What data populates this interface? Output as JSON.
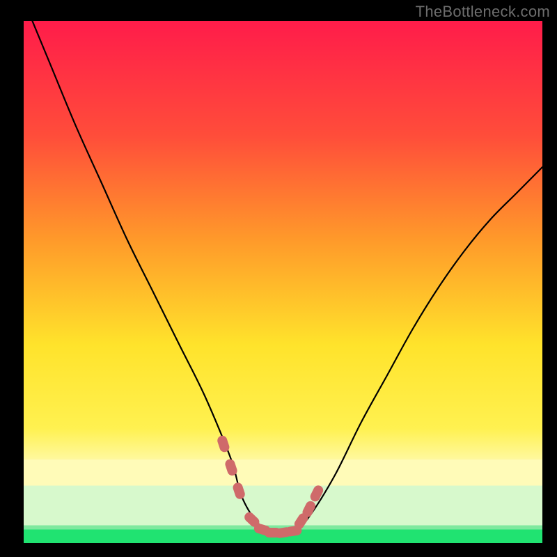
{
  "watermark": "TheBottleneck.com",
  "colors": {
    "black": "#000000",
    "curve": "#000000",
    "marker": "#cf6a6a",
    "green_band": "#20e371",
    "pale_green": "#d7f9cc",
    "grad_top": "#ff1c4a",
    "grad_mid1": "#ff7a2e",
    "grad_mid2": "#ffe32b",
    "grad_pale": "#fffbb8",
    "grad_bottom": "#20e371"
  },
  "chart_data": {
    "type": "line",
    "title": "",
    "xlabel": "",
    "ylabel": "",
    "xlim": [
      0,
      100
    ],
    "ylim": [
      0,
      100
    ],
    "grid": false,
    "legend": false,
    "series": [
      {
        "name": "bottleneck-curve",
        "x": [
          0,
          5,
          10,
          15,
          20,
          25,
          30,
          35,
          40,
          42,
          45,
          48,
          52,
          55,
          60,
          65,
          70,
          75,
          80,
          85,
          90,
          95,
          100
        ],
        "values": [
          104,
          92,
          80,
          69,
          58,
          48,
          38,
          28,
          16,
          9,
          4,
          2,
          2,
          5,
          13,
          23,
          32,
          41,
          49,
          56,
          62,
          67,
          72
        ]
      }
    ],
    "markers": [
      {
        "name": "left-approach",
        "x": [
          38.5,
          40,
          41.5
        ],
        "y": [
          19,
          14.5,
          10
        ]
      },
      {
        "name": "valley-floor",
        "x": [
          44,
          46,
          48,
          50,
          52
        ],
        "y": [
          4.5,
          2.6,
          2,
          2,
          2.3
        ]
      },
      {
        "name": "right-approach",
        "x": [
          53.5,
          55,
          56.5
        ],
        "y": [
          4.2,
          6.5,
          9.5
        ]
      }
    ],
    "bands": [
      {
        "name": "pale-yellow-band",
        "y0": 11,
        "y1": 16
      },
      {
        "name": "pale-green-band",
        "y0": 3,
        "y1": 11
      },
      {
        "name": "green-band",
        "y0": 0,
        "y1": 3
      }
    ],
    "notes": "Background is a vertical continuous gradient from red at top through orange and yellow to pale yellow, then discrete pale-green and solid-green bands at the very bottom. A single black curve forms a deep asymmetric V with minimum near x≈49, y≈2. Salmon-colored thick dotted markers trace the curve near the valley. No axis ticks or labels shown. Values estimated from pixels in 0–100 space."
  }
}
